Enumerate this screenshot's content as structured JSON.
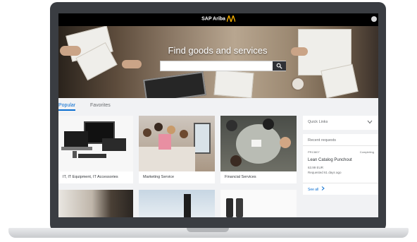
{
  "header": {
    "brand": "SAP Ariba"
  },
  "hero": {
    "title": "Find goods and services",
    "search_placeholder": ""
  },
  "tabs": [
    {
      "label": "Popular",
      "active": true
    },
    {
      "label": "Favorites",
      "active": false
    }
  ],
  "tiles": [
    {
      "label": "IT, IT Equipment, IT Accessories"
    },
    {
      "label": "Marketing Service"
    },
    {
      "label": "Financial Services"
    }
  ],
  "sidebar": {
    "quick_links": "Quick Links",
    "recent_requests": "Recent requests",
    "request": {
      "id": "PR13807",
      "status": "Completing",
      "title": "Lean Catalog Punchout",
      "amount": "63.99 EUR",
      "requested": "Requested 61 days ago"
    },
    "see_all": "See all"
  },
  "colors": {
    "accent": "#0a6ed1",
    "topbar": "#000000",
    "brand_logo": "#f0ab00"
  }
}
